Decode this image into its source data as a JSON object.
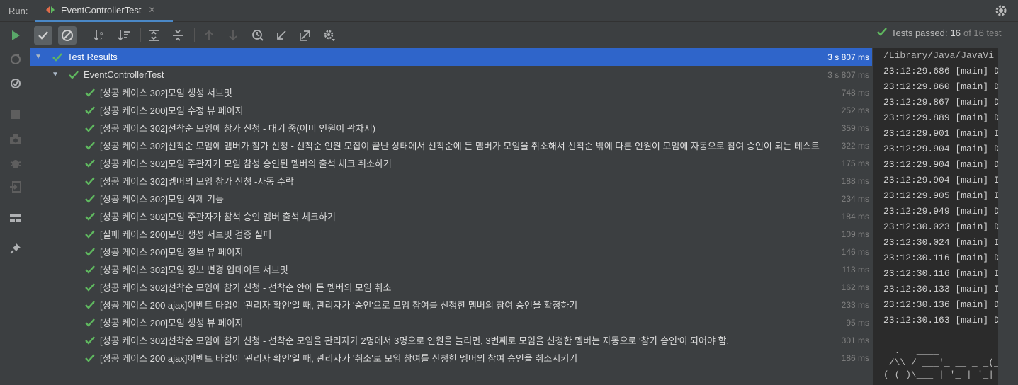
{
  "runbar": {
    "label": "Run:",
    "tab_title": "EventControllerTest",
    "close": "✕"
  },
  "status": {
    "text": "Tests passed:",
    "count": "16",
    "of": "of 16 test"
  },
  "tree": {
    "root": {
      "label": "Test Results",
      "time": "3 s 807 ms"
    },
    "suite": {
      "label": "EventControllerTest",
      "time": "3 s 807 ms"
    },
    "tests": [
      {
        "name": "[성공 케이스 302]모임 생성 서브밋",
        "time": "748 ms"
      },
      {
        "name": "[성공 케이스 200]모임 수정 뷰 페이지",
        "time": "252 ms"
      },
      {
        "name": "[성공 케이스 302]선착순 모임에 참가 신청 - 대기 중(이미 인원이 꽉차서)",
        "time": "359 ms"
      },
      {
        "name": "[성공 케이스 302]선착순 모임에 멤버가 참가 신청 - 선착순 인원 모집이 끝난 상태에서 선착순에 든 멤버가 모임을 취소해서 선착순 밖에 다른 인원이 모임에 자동으로 참여 승인이 되는 테스트",
        "time": "322 ms"
      },
      {
        "name": "[성공 케이스 302]모임 주관자가 모임 참성 승인된 멤버의 출석 체크 취소하기",
        "time": "175 ms"
      },
      {
        "name": "[성공 케이스 302]멤버의 모임 참가 신청 -자동 수락",
        "time": "188 ms"
      },
      {
        "name": "[성공 케이스 302]모임 삭제 기능",
        "time": "234 ms"
      },
      {
        "name": "[성공 케이스 302]모임 주관자가 참석 승인 멤버 출석 체크하기",
        "time": "184 ms"
      },
      {
        "name": "[실패 케이스 200]모임 생성 서브밋 검증 실패",
        "time": "109 ms"
      },
      {
        "name": "[성공 케이스 200]모임 정보 뷰 페이지",
        "time": "146 ms"
      },
      {
        "name": "[성공 케이스 302]모임 정보 변경 업데이트 서브밋",
        "time": "113 ms"
      },
      {
        "name": "[성공 케이스 302]선착순 모임에 참가 신청 - 선착순 안에 든 멤버의 모임 취소",
        "time": "162 ms"
      },
      {
        "name": "[성공 케이스 200 ajax]이벤트 타입이 '관리자 확인'일 때, 관리자가 '승인'으로 모임 참여를 신청한 멤버의 참여 승인을 확정하기",
        "time": "233 ms"
      },
      {
        "name": "[성공 케이스 200]모임 생성 뷰 페이지",
        "time": "95 ms"
      },
      {
        "name": "[성공 케이스 302]선착순 모임에 참가 신청 - 선착순 모임을 관리자가 2명에서 3명으로 인원을 늘리면, 3번째로 모임을 신청한 멤버는 자동으로 '참가 승인'이 되어야 함.",
        "time": "301 ms"
      },
      {
        "name": "[성공 케이스 200 ajax]이벤트 타입이 '관리자 확인'일 때, 관리자가 '취소'로 모임 참여를 신청한 멤버의 참여 승인을 취소시키기",
        "time": "186 ms"
      }
    ]
  },
  "console": {
    "path": "/Library/Java/JavaVi",
    "lines": [
      "23:12:29.686 [main] D",
      "23:12:29.860 [main] D",
      "23:12:29.867 [main] D",
      "23:12:29.889 [main] D",
      "23:12:29.901 [main] I",
      "23:12:29.904 [main] D",
      "23:12:29.904 [main] D",
      "23:12:29.904 [main] I",
      "23:12:29.905 [main] I",
      "23:12:29.949 [main] D",
      "23:12:30.023 [main] D",
      "23:12:30.024 [main] I",
      "23:12:30.116 [main] D",
      "23:12:30.116 [main] I",
      "23:12:30.133 [main] I",
      "23:12:30.136 [main] D",
      "23:12:30.163 [main] D"
    ],
    "art": [
      "  .   ____          ",
      " /\\\\ / ___'_ __ _ _(_",
      "( ( )\\___ | '_ | '_| "
    ]
  },
  "colors": {
    "pass_green": "#5fb85f",
    "selection": "#2f65ca",
    "run_green": "#59a869"
  }
}
